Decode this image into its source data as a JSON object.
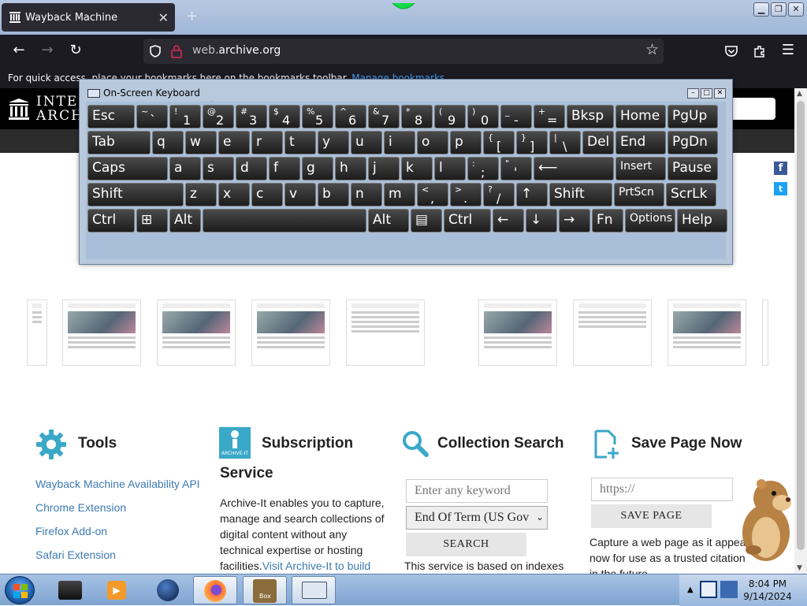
{
  "browser": {
    "tab_title": "Wayback Machine",
    "url_host": "web.",
    "url_domain": "archive.org",
    "bookmarks_text": "For quick access, place your bookmarks here on the bookmarks toolbar.",
    "bookmarks_link": "Manage bookmarks"
  },
  "site": {
    "brand_line1": "INTER",
    "brand_line2": "ARCHI"
  },
  "keyboard": {
    "title": "On-Screen Keyboard",
    "rows": [
      [
        {
          "main": "Esc"
        },
        {
          "shift": "~",
          "base": "`"
        },
        {
          "shift": "!",
          "base": "1"
        },
        {
          "shift": "@",
          "base": "2"
        },
        {
          "shift": "#",
          "base": "3"
        },
        {
          "shift": "$",
          "base": "4"
        },
        {
          "shift": "%",
          "base": "5"
        },
        {
          "shift": "^",
          "base": "6"
        },
        {
          "shift": "&",
          "base": "7"
        },
        {
          "shift": "*",
          "base": "8"
        },
        {
          "shift": "(",
          "base": "9"
        },
        {
          "shift": ")",
          "base": "0"
        },
        {
          "shift": "_",
          "base": "-"
        },
        {
          "shift": "+",
          "base": "="
        },
        {
          "main": "Bksp"
        },
        {
          "main": "Home"
        },
        {
          "main": "PgUp"
        }
      ],
      [
        {
          "main": "Tab"
        },
        {
          "main": "q"
        },
        {
          "main": "w"
        },
        {
          "main": "e"
        },
        {
          "main": "r"
        },
        {
          "main": "t"
        },
        {
          "main": "y"
        },
        {
          "main": "u"
        },
        {
          "main": "i"
        },
        {
          "main": "o"
        },
        {
          "main": "p"
        },
        {
          "shift": "{",
          "base": "["
        },
        {
          "shift": "}",
          "base": "]"
        },
        {
          "shift": "|",
          "base": "\\"
        },
        {
          "main": "Del"
        },
        {
          "main": "End"
        },
        {
          "main": "PgDn"
        }
      ],
      [
        {
          "main": "Caps"
        },
        {
          "main": "a"
        },
        {
          "main": "s"
        },
        {
          "main": "d"
        },
        {
          "main": "f"
        },
        {
          "main": "g"
        },
        {
          "main": "h"
        },
        {
          "main": "j"
        },
        {
          "main": "k"
        },
        {
          "main": "l"
        },
        {
          "shift": ":",
          "base": ";"
        },
        {
          "shift": "\"",
          "base": "'"
        },
        {
          "main": "⟵"
        },
        {
          "main": "Insert"
        },
        {
          "main": "Pause"
        }
      ],
      [
        {
          "main": "Shift"
        },
        {
          "main": "z"
        },
        {
          "main": "x"
        },
        {
          "main": "c"
        },
        {
          "main": "v"
        },
        {
          "main": "b"
        },
        {
          "main": "n"
        },
        {
          "main": "m"
        },
        {
          "shift": "<",
          "base": ","
        },
        {
          "shift": ">",
          "base": "."
        },
        {
          "shift": "?",
          "base": "/"
        },
        {
          "main": "↑"
        },
        {
          "main": "Shift"
        },
        {
          "main": "PrtScn"
        },
        {
          "main": "ScrLk"
        }
      ],
      [
        {
          "main": "Ctrl"
        },
        {
          "main": "⊞"
        },
        {
          "main": "Alt"
        },
        {
          "main": ""
        },
        {
          "main": "Alt"
        },
        {
          "main": "▤"
        },
        {
          "main": "Ctrl"
        },
        {
          "main": "←"
        },
        {
          "main": "↓"
        },
        {
          "main": "→"
        },
        {
          "main": "Fn"
        },
        {
          "main": "Options"
        },
        {
          "main": "Help"
        }
      ]
    ]
  },
  "tools": {
    "heading": "Tools",
    "links": [
      "Wayback Machine Availability API",
      "Chrome Extension",
      "Firefox Add-on",
      "Safari Extension"
    ]
  },
  "subscription": {
    "heading_line1": "Subscription",
    "heading_line2": "Service",
    "icon_label": "ARCHIVE-IT",
    "text": "Archive-It enables you to capture, manage and search collections of digital content without any technical expertise or hosting facilities.",
    "link": "Visit Archive-It to build"
  },
  "collection_search": {
    "heading": "Collection Search",
    "placeholder": "Enter any keyword",
    "select_value": "End Of Term (US Gov",
    "button": "SEARCH",
    "text": "This service is based on indexes"
  },
  "save_page": {
    "heading": "Save Page Now",
    "placeholder": "https://",
    "button": "SAVE PAGE",
    "text1": "Capture a web page as it appea",
    "text2": "now for use as a trusted citation",
    "text3": "in the future."
  },
  "taskbar": {
    "time": "8:04 PM",
    "date": "9/14/2024",
    "box_label": "Box"
  },
  "colors": {
    "accent_link": "#3d7ab3",
    "icon_teal": "#3aa8c7",
    "browser_dark": "#1c1b22"
  }
}
